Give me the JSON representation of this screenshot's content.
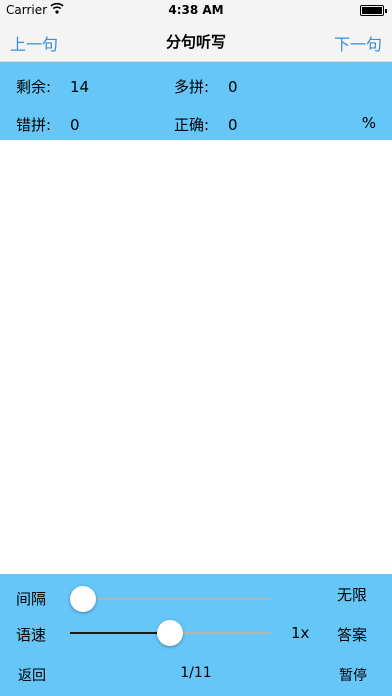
{
  "status_bar": {
    "carrier": "Carrier",
    "wifi": "wifi-icon",
    "time": "4:38 AM",
    "battery": "battery-icon"
  },
  "nav": {
    "prev_label": "上一句",
    "title": "分句听写",
    "next_label": "下一句"
  },
  "stats": {
    "remaining_label": "剩余:",
    "remaining_value": "14",
    "extra_label": "多拼:",
    "extra_value": "0",
    "wrong_label": "错拼:",
    "wrong_value": "0",
    "correct_label": "正确:",
    "correct_value": "0",
    "percent_label": "%"
  },
  "controls": {
    "interval_label": "间隔",
    "interval_value": "无限",
    "interval_level": 0,
    "speed_label": "语速",
    "speed_value": "1x",
    "speed_level": 0.5,
    "answer_label": "答案",
    "back_label": "返回",
    "page": "1/11",
    "pause_label": "暂停"
  },
  "colors": {
    "accent": "#66c6f8",
    "link": "#3b8fd8",
    "bar": "#f4f4f4"
  }
}
